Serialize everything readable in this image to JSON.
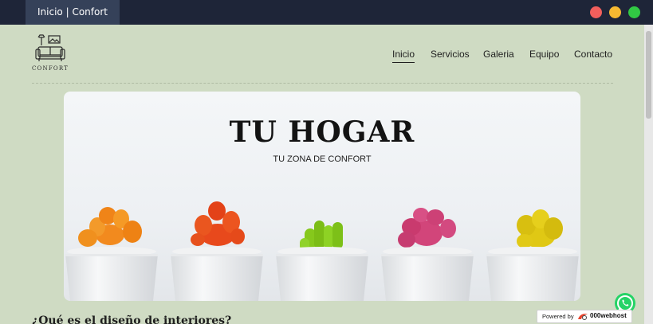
{
  "window": {
    "tab_title": "Inicio | Confort"
  },
  "header": {
    "logo_text": "CONFORT",
    "nav": [
      {
        "label": "Inicio",
        "active": true
      },
      {
        "label": "Servicios",
        "active": false
      },
      {
        "label": "Galeria",
        "active": false
      },
      {
        "label": "Equipo",
        "active": false
      },
      {
        "label": "Contacto",
        "active": false
      }
    ]
  },
  "hero": {
    "title": "TU HOGAR",
    "subtitle": "TU ZONA DE CONFORT"
  },
  "section": {
    "heading": "¿Qué es el diseño de interiores?"
  },
  "badge": {
    "powered": "Powered by",
    "brand": "000webhost"
  },
  "colors": {
    "page_background": "#cfdbc3",
    "titlebar": "#1e2538",
    "whatsapp": "#25d366",
    "cactus_orange": "#f28a1e",
    "cactus_red": "#e8491c",
    "cactus_green": "#86c81c",
    "cactus_pink": "#d2457a",
    "cactus_yellow": "#e0c814"
  },
  "icons": {
    "logo": "sofa-lamp-icon",
    "whatsapp": "whatsapp-icon",
    "badge": "000webhost-logo-icon"
  }
}
